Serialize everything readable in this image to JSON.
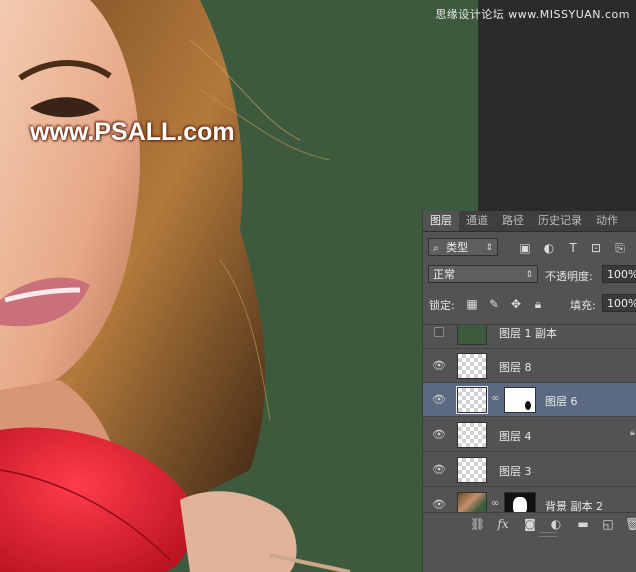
{
  "watermarks": {
    "top_right": "思缘设计论坛 www.MISSYUAN.com",
    "site": "www.PSALL.com"
  },
  "panel": {
    "tabs": [
      "图层",
      "通道",
      "路径",
      "历史记录",
      "动作"
    ],
    "active_tab": "图层",
    "filter": {
      "label": "类型",
      "icon": "search-icon"
    },
    "filter_icons": [
      "image-filter-icon",
      "adjustment-filter-icon",
      "type-filter-icon",
      "shape-filter-icon",
      "smart-object-filter-icon"
    ],
    "blend_mode": "正常",
    "opacity_label": "不透明度:",
    "opacity_value": "100%",
    "lock_label": "锁定:",
    "fill_label": "填充:",
    "fill_value": "100%",
    "layers": [
      {
        "name": "图层 1 副本",
        "visible": false,
        "thumb": "green",
        "mask": null,
        "selected": false,
        "locked": false
      },
      {
        "name": "图层 8",
        "visible": true,
        "thumb": "transparent",
        "mask": null,
        "selected": false,
        "locked": false
      },
      {
        "name": "图层 6",
        "visible": true,
        "thumb": "transparent",
        "mask": "white",
        "selected": true,
        "locked": false
      },
      {
        "name": "图层 4",
        "visible": true,
        "thumb": "transparent",
        "mask": null,
        "selected": false,
        "locked": true
      },
      {
        "name": "图层 3",
        "visible": true,
        "thumb": "transparent",
        "mask": null,
        "selected": false,
        "locked": false
      },
      {
        "name": "背景 副本 2",
        "visible": true,
        "thumb": "photo",
        "mask": "black",
        "selected": false,
        "locked": false
      }
    ],
    "footer_icons": [
      "link-layers-icon",
      "fx-icon",
      "add-mask-icon",
      "adjustment-layer-icon",
      "new-group-icon",
      "new-layer-icon",
      "delete-layer-icon"
    ],
    "footer_fx_label": "fx"
  },
  "colors": {
    "canvas_background": "#3d5a3e",
    "panel_background": "#535353",
    "selected_layer": "#5b6a82"
  }
}
